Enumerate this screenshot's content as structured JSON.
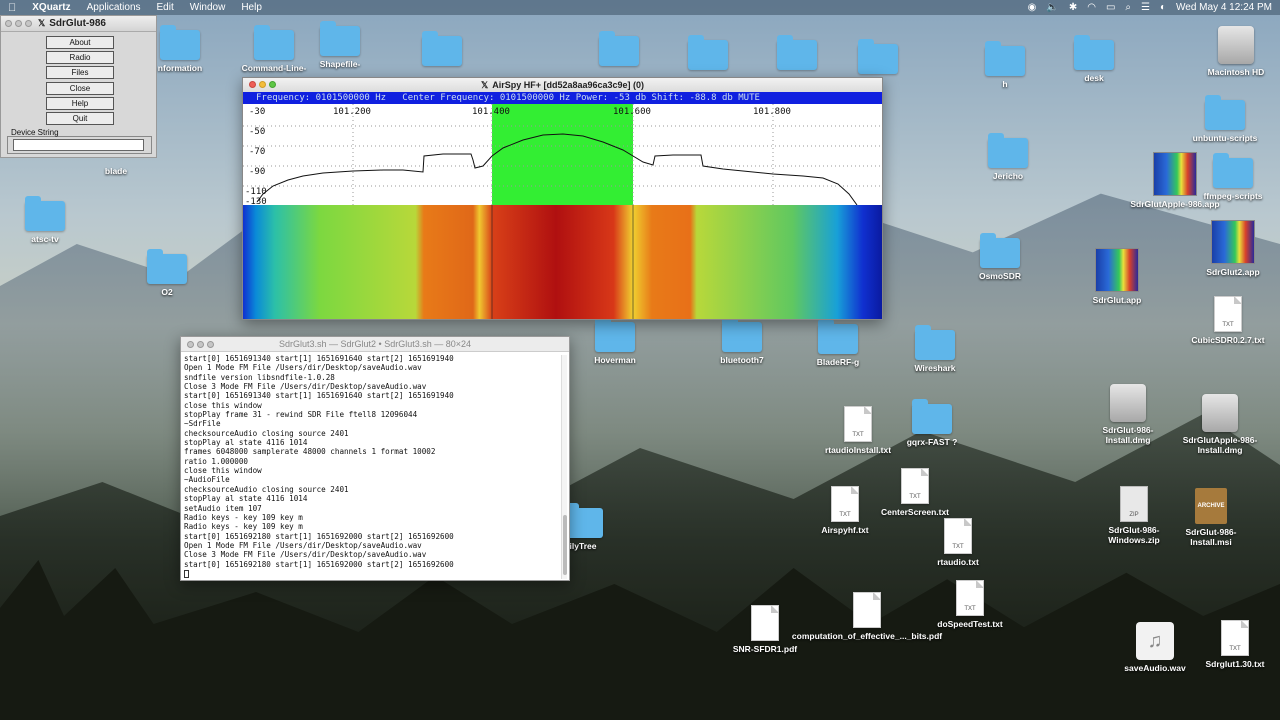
{
  "menubar": {
    "apple": "",
    "app": "XQuartz",
    "items": [
      "Applications",
      "Edit",
      "Window",
      "Help"
    ],
    "clock": "Wed May 4  12:24 PM"
  },
  "desktop": {
    "icons": [
      {
        "label": "nformation",
        "type": "folder"
      },
      {
        "label": "Command-Line-",
        "type": "folder"
      },
      {
        "label": "Shapefile-",
        "type": "folder"
      },
      {
        "label": "",
        "type": "folder"
      },
      {
        "label": "",
        "type": "folder"
      },
      {
        "label": "",
        "type": "folder"
      },
      {
        "label": "",
        "type": "folder"
      },
      {
        "label": "",
        "type": "folder"
      },
      {
        "label": "h",
        "type": "folder"
      },
      {
        "label": "desk",
        "type": "folder"
      },
      {
        "label": "Macintosh HD",
        "type": "disk"
      },
      {
        "label": "unbuntu-scripts",
        "type": "folder"
      },
      {
        "label": "ffmpeg-scripts",
        "type": "folder"
      },
      {
        "label": "SdrGlutApple-986.app",
        "type": "app"
      },
      {
        "label": "Jericho",
        "type": "folder"
      },
      {
        "label": "blade",
        "type": "text"
      },
      {
        "label": "atsc-tv",
        "type": "folder"
      },
      {
        "label": "O2",
        "type": "folder"
      },
      {
        "label": "OsmoSDR",
        "type": "folder"
      },
      {
        "label": "SdrGlut.app",
        "type": "app"
      },
      {
        "label": "SdrGlut2.app",
        "type": "app"
      },
      {
        "label": "CubicSDR0.2.7.txt",
        "type": "doc"
      },
      {
        "label": "Hoverman",
        "type": "folder"
      },
      {
        "label": "bluetooth7",
        "type": "folder"
      },
      {
        "label": "BladeRF-g",
        "type": "folder"
      },
      {
        "label": "Wireshark",
        "type": "folder"
      },
      {
        "label": "gqrx-FAST ?",
        "type": "folder"
      },
      {
        "label": "rtaudioInstall.txt",
        "type": "doc"
      },
      {
        "label": "CenterScreen.txt",
        "type": "doc"
      },
      {
        "label": "Airspyhf.txt",
        "type": "doc"
      },
      {
        "label": "rtaudio.txt",
        "type": "doc"
      },
      {
        "label": "SdrGlut-986-Install.dmg",
        "type": "disk"
      },
      {
        "label": "SdrGlutApple-986-Install.dmg",
        "type": "disk"
      },
      {
        "label": "ilyTree",
        "type": "folder"
      },
      {
        "label": "SdrGlut-986-Windows.zip",
        "type": "zip"
      },
      {
        "label": "SdrGlut-986-Install.msi",
        "type": "archive"
      },
      {
        "label": "doSpeedTest.txt",
        "type": "doc"
      },
      {
        "label": "SNR-SFDR1.pdf",
        "type": "pdf"
      },
      {
        "label": "computation_of_effective_..._bits.pdf",
        "type": "pdf"
      },
      {
        "label": "saveAudio.wav",
        "type": "wav"
      },
      {
        "label": "Sdrglut1.30.txt",
        "type": "doc"
      }
    ],
    "doc_tag": "TXT",
    "zip_tag": "ZIP",
    "archive_tag": "ARCHIVE",
    "wav_glyph": "♫"
  },
  "panel": {
    "title": "SdrGlut-986",
    "buttons": [
      "About",
      "Radio",
      "Files",
      "Close",
      "Help",
      "Quit"
    ],
    "device_label": "Device String",
    "device_value": ""
  },
  "airspy": {
    "title": "AirSpy HF+ [dd52a8aa96ca3c9e] (0)",
    "status": "Frequency: 0101500000 Hz   Center Frequency: 0101500000 Hz Power: -53 db Shift: -88.8 db MUTE",
    "freq_ticks": [
      "101.200",
      "101.400",
      "101.600",
      "101.800"
    ],
    "db_ticks": [
      "-30",
      "-50",
      "-70",
      "-90",
      "-110",
      "-130"
    ],
    "colors": {
      "status_bg": "#1020e0",
      "passband": "#33ee33"
    }
  },
  "terminal": {
    "title": "SdrGlut3.sh — SdrGlut2 • SdrGlut3.sh — 80×24",
    "lines": [
      "start[0] 1651691340 start[1] 1651691640 start[2] 1651691940",
      "Open 1 Mode FM File /Users/dir/Desktop/saveAudio.wav",
      "sndfile version libsndfile-1.0.28",
      "Close 3 Mode FM File /Users/dir/Desktop/saveAudio.wav",
      "start[0] 1651691340 start[1] 1651691640 start[2] 1651691940",
      "close this window",
      "stopPlay frame 31 - rewind SDR File ftell8 12096044",
      "~SdrFile",
      "checksourceAudio closing source 2401",
      "stopPlay al state 4116 1014",
      "frames 6048000 samplerate 48000 channels 1 format 10002",
      "ratio 1.000000",
      "close this window",
      "~AudioFile",
      "checksourceAudio closing source 2401",
      "stopPlay al state 4116 1014",
      "setAudio item 107",
      "Radio keys - key 109 key m",
      "Radio keys - key 109 key m",
      "start[0] 1651692180 start[1] 1651692000 start[2] 1651692600",
      "Open 1 Mode FM File /Users/dir/Desktop/saveAudio.wav",
      "Close 3 Mode FM File /Users/dir/Desktop/saveAudio.wav",
      "start[0] 1651692180 start[1] 1651692000 start[2] 1651692600"
    ]
  }
}
